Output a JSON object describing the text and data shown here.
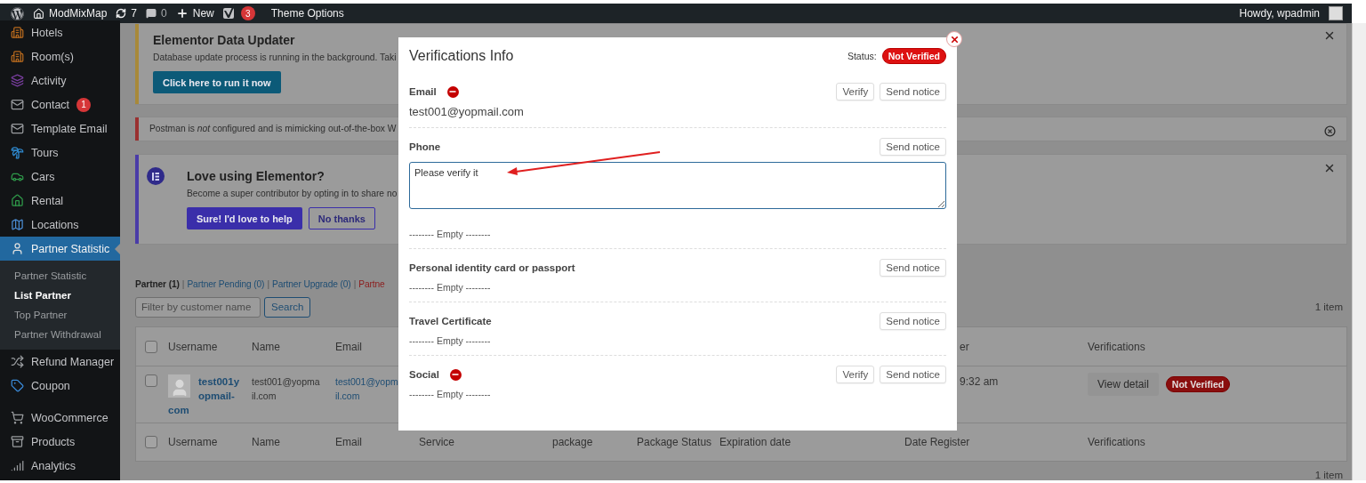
{
  "admin_bar": {
    "site": "ModMixMap",
    "updates": "7",
    "comments": "0",
    "new": "New",
    "seo_badge": "3",
    "theme_options": "Theme Options",
    "greeting": "Howdy, wpadmin"
  },
  "sidebar": {
    "items": [
      {
        "label": "Hotels",
        "selected": false
      },
      {
        "label": "Room(s)",
        "selected": false
      },
      {
        "label": "Activity",
        "selected": false
      },
      {
        "label": "Contact",
        "selected": false,
        "badge": "1"
      },
      {
        "label": "Template Email",
        "selected": false
      },
      {
        "label": "Tours",
        "selected": false
      },
      {
        "label": "Cars",
        "selected": false
      },
      {
        "label": "Rental",
        "selected": false
      },
      {
        "label": "Locations",
        "selected": false
      },
      {
        "label": "Partner Statistic",
        "selected": true,
        "children": [
          {
            "label": "Partner Statistic",
            "selected": false
          },
          {
            "label": "List Partner",
            "selected": true
          },
          {
            "label": "Top Partner",
            "selected": false
          },
          {
            "label": "Partner Withdrawal",
            "selected": false
          }
        ]
      },
      {
        "label": "Refund Manager",
        "selected": false
      },
      {
        "label": "Coupon",
        "selected": false
      },
      {
        "label": "WooCommerce",
        "selected": false
      },
      {
        "label": "Products",
        "selected": false
      },
      {
        "label": "Analytics",
        "selected": false
      }
    ]
  },
  "notices": [
    {
      "kind": "updater",
      "color": "#a8893a",
      "title": "Elementor Data Updater",
      "text": "Database update process is running in the background. Taki",
      "buttons": [
        "Click here to run it now"
      ]
    },
    {
      "kind": "warning",
      "color": "#9a3030",
      "text": "Postman is *not* configured and is mimicking out-of-the-box W"
    },
    {
      "kind": "promo",
      "color": "#4a3ca8",
      "title": "Love using Elementor?",
      "text": "Become a super contributor by opting in to share no",
      "buttons": [
        "Sure! I'd love to help",
        "No thanks"
      ]
    }
  ],
  "views": [
    {
      "label": "Partner (1)",
      "selected": true,
      "kind": "link"
    },
    {
      "label": "Partner Pending (0)",
      "selected": false,
      "kind": "link",
      "separator": "|"
    },
    {
      "label": "Partner Upgrade (0)",
      "selected": false,
      "kind": "link",
      "separator": "|"
    },
    {
      "label": "Partne",
      "selected": false,
      "kind": "danger",
      "separator": "|"
    }
  ],
  "search": {
    "placeholder": "Filter by customer name",
    "button": "Search"
  },
  "item_count_top": "1 item",
  "table": {
    "rows": [
      {
        "kind": "header",
        "checked": false,
        "cells": [
          "Username",
          "Name",
          "Email",
          null,
          null,
          null,
          null,
          "er",
          "Verifications"
        ]
      },
      {
        "kind": "body",
        "checked": false,
        "cells": [
          {
            "kind": "user",
            "lines": [
              "test001y",
              "opmail-",
              "com"
            ]
          },
          {
            "kind": "lines",
            "lines": [
              "test001@yopma",
              "il.com"
            ]
          },
          {
            "kind": "link",
            "lines": [
              "test001@yopm",
              "il.com"
            ]
          },
          null,
          null,
          null,
          null,
          "9:32 am",
          {
            "kind": "actions",
            "button": "View detail",
            "badge": "Not Verified"
          }
        ]
      },
      {
        "kind": "footer",
        "checked": false,
        "cells": [
          "Username",
          "Name",
          "Email",
          "Service",
          "package",
          "Package Status",
          "Expiration date",
          "Date Register",
          "Verifications"
        ]
      }
    ]
  },
  "item_count_bottom": "1 item",
  "modal": {
    "title": "Verifications Info",
    "status_label": "Status:",
    "status": "Not Verified",
    "sections": [
      {
        "label": "Email",
        "flagged": true,
        "buttons": [
          "Verify",
          "Send notice"
        ],
        "value": "test001@yopmail.com"
      },
      {
        "label": "Phone",
        "flagged": false,
        "buttons": [
          "Send notice"
        ],
        "note": "Please verify it",
        "empty": "-------- Empty --------"
      },
      {
        "label": "Personal identity card or passport",
        "flagged": false,
        "buttons": [
          "Send notice"
        ],
        "empty": "-------- Empty --------"
      },
      {
        "label": "Travel Certificate",
        "flagged": false,
        "buttons": [
          "Send notice"
        ],
        "empty": "-------- Empty --------"
      },
      {
        "label": "Social",
        "flagged": true,
        "buttons": [
          "Verify",
          "Send notice"
        ],
        "empty": "-------- Empty --------"
      }
    ]
  },
  "annotation": {
    "kind": "arrow"
  }
}
